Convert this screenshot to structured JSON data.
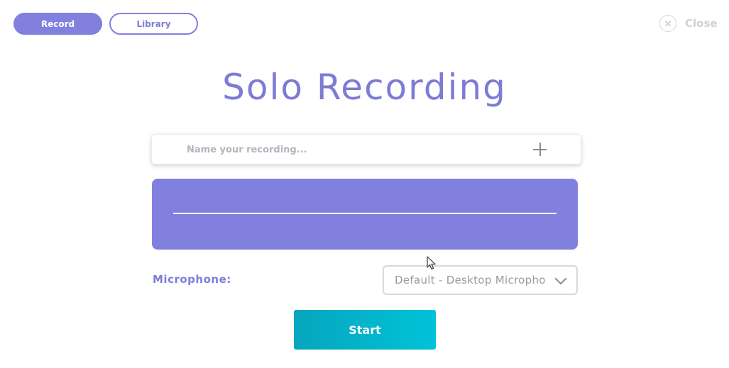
{
  "tabs": {
    "record_label": "Record",
    "library_label": "Library"
  },
  "close": {
    "label": "Close",
    "icon": "close-icon"
  },
  "title": "Solo Recording",
  "name_input": {
    "placeholder": "Name your recording...",
    "value": "",
    "add_icon": "plus-icon"
  },
  "microphone": {
    "label": "Microphone:",
    "selected": "Default - Desktop Microphone"
  },
  "start_label": "Start",
  "colors": {
    "accent": "#8280de",
    "start_gradient_from": "#06a6bd",
    "start_gradient_to": "#00c2d8",
    "muted": "#d0d0d8"
  }
}
